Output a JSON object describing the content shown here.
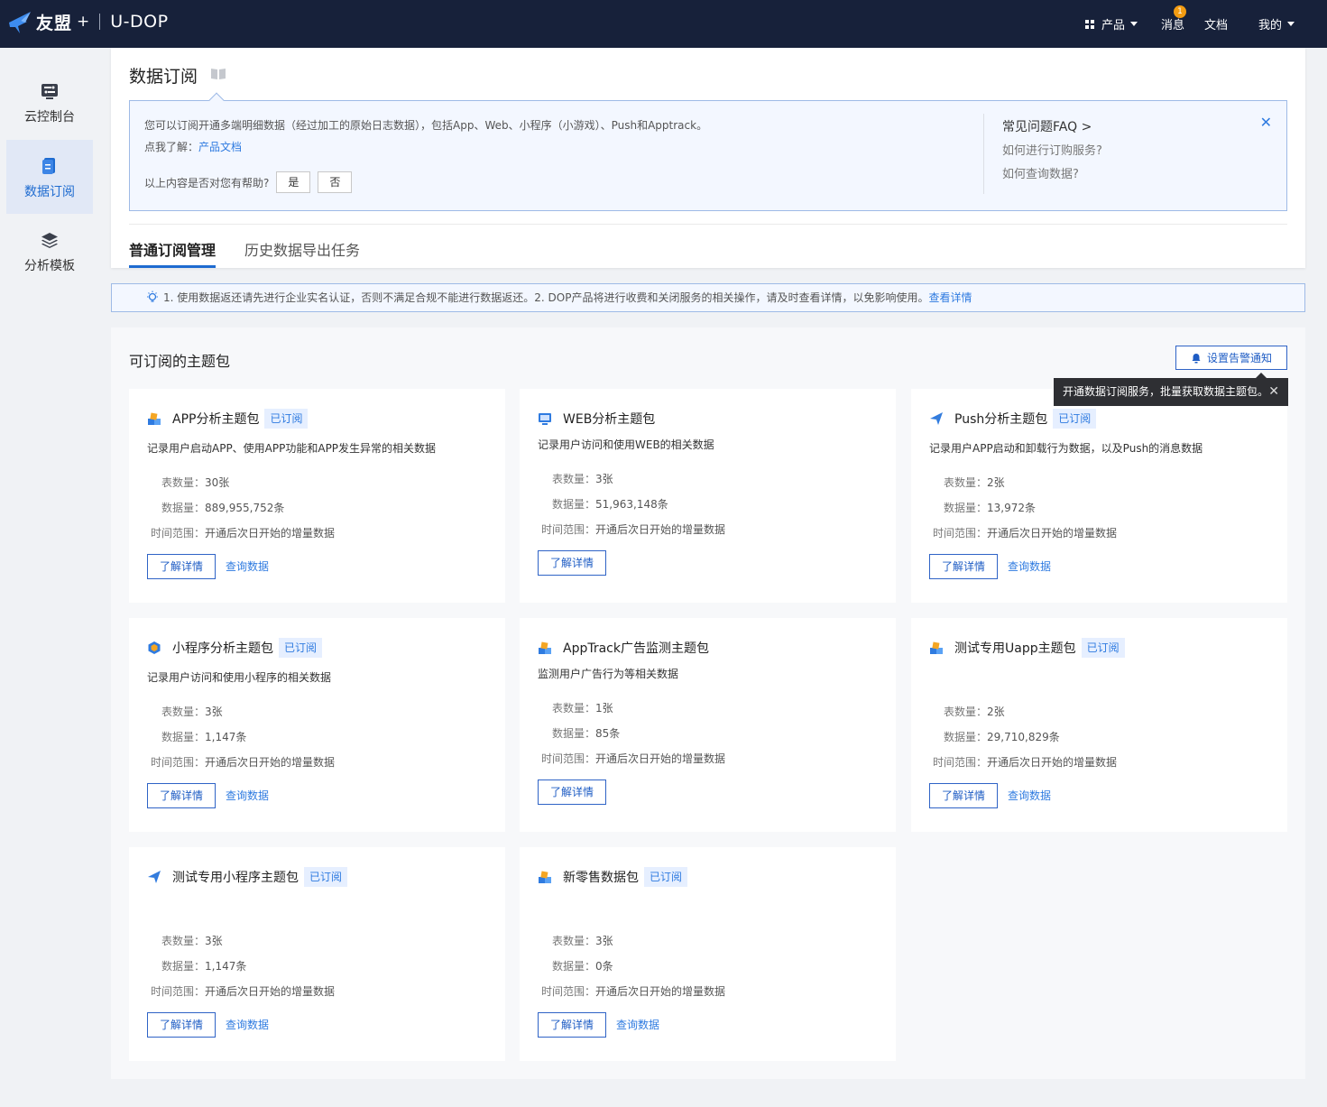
{
  "topbar": {
    "brand": "友盟",
    "plus": "+",
    "product_name": "U-DOP",
    "nav": {
      "products": "产品",
      "messages": "消息",
      "messages_badge": "1",
      "docs": "文档",
      "mine": "我的"
    }
  },
  "sidebar": {
    "items": [
      {
        "label": "云控制台",
        "icon": "console-icon"
      },
      {
        "label": "数据订阅",
        "icon": "document-icon",
        "active": true
      },
      {
        "label": "分析模板",
        "icon": "layers-icon"
      }
    ]
  },
  "page": {
    "title": "数据订阅",
    "info": {
      "text": "您可以订阅开通多端明细数据（经过加工的原始日志数据），包括App、Web、小程序（小游戏）、Push和Apptrack。",
      "learn_prefix": "点我了解：",
      "learn_link": "产品文档",
      "helpful_question": "以上内容是否对您有帮助?",
      "yes": "是",
      "no": "否",
      "faq_title": "常见问题FAQ >",
      "faq_q1": "如何进行订购服务?",
      "faq_q2": "如何查询数据?",
      "close": "✕"
    },
    "tabs": [
      "普通订阅管理",
      "历史数据导出任务"
    ]
  },
  "notice": {
    "text": "1. 使用数据返还请先进行企业实名认证，否则不满足合规不能进行数据返还。2. DOP产品将进行收费和关闭服务的相关操作，请及时查看详情，以免影响使用。",
    "link": "查看详情"
  },
  "packages": {
    "section_title": "可订阅的主题包",
    "alert_button": "设置告警通知",
    "tooltip": "开通数据订阅服务，批量获取数据主题包。",
    "labels": {
      "tables": "表数量：",
      "records": "数据量：",
      "time_range": "时间范围：",
      "detail_button": "了解详情",
      "query_link": "查询数据"
    },
    "cards": [
      {
        "title": "APP分析主题包",
        "tag": "已订阅",
        "icon": "app-package-icon",
        "desc": "记录用户启动APP、使用APP功能和APP发生异常的相关数据",
        "tables": "30张",
        "records": "889,955,752条",
        "time_range": "开通后次日开始的增量数据",
        "has_query": true
      },
      {
        "title": "WEB分析主题包",
        "tag": "",
        "icon": "monitor-icon",
        "desc": "记录用户访问和使用WEB的相关数据",
        "tables": "3张",
        "records": "51,963,148条",
        "time_range": "开通后次日开始的增量数据",
        "has_query": false
      },
      {
        "title": "Push分析主题包",
        "tag": "已订阅",
        "icon": "paper-plane-icon",
        "desc": "记录用户APP启动和卸载行为数据，以及Push的消息数据",
        "tables": "2张",
        "records": "13,972条",
        "time_range": "开通后次日开始的增量数据",
        "has_query": true
      },
      {
        "title": "小程序分析主题包",
        "tag": "已订阅",
        "icon": "miniprogram-icon",
        "desc": "记录用户访问和使用小程序的相关数据",
        "tables": "3张",
        "records": "1,147条",
        "time_range": "开通后次日开始的增量数据",
        "has_query": true
      },
      {
        "title": "AppTrack广告监测主题包",
        "tag": "",
        "icon": "app-package-icon",
        "desc": "监测用户广告行为等相关数据",
        "tables": "1张",
        "records": "85条",
        "time_range": "开通后次日开始的增量数据",
        "has_query": false
      },
      {
        "title": "测试专用Uapp主题包",
        "tag": "已订阅",
        "icon": "app-package-icon",
        "desc": "",
        "tables": "2张",
        "records": "29,710,829条",
        "time_range": "开通后次日开始的增量数据",
        "has_query": true
      },
      {
        "title": "测试专用小程序主题包",
        "tag": "已订阅",
        "icon": "paper-plane-icon",
        "desc": "",
        "tables": "3张",
        "records": "1,147条",
        "time_range": "开通后次日开始的增量数据",
        "has_query": true
      },
      {
        "title": "新零售数据包",
        "tag": "已订阅",
        "icon": "app-package-icon",
        "desc": "",
        "tables": "3张",
        "records": "0条",
        "time_range": "开通后次日开始的增量数据",
        "has_query": true
      }
    ]
  },
  "colors": {
    "topbar_bg": "#17213a",
    "accent": "#1e6bd0",
    "link": "#2f7be0",
    "tag_bg": "#e6efff",
    "badge": "#f39c12"
  }
}
